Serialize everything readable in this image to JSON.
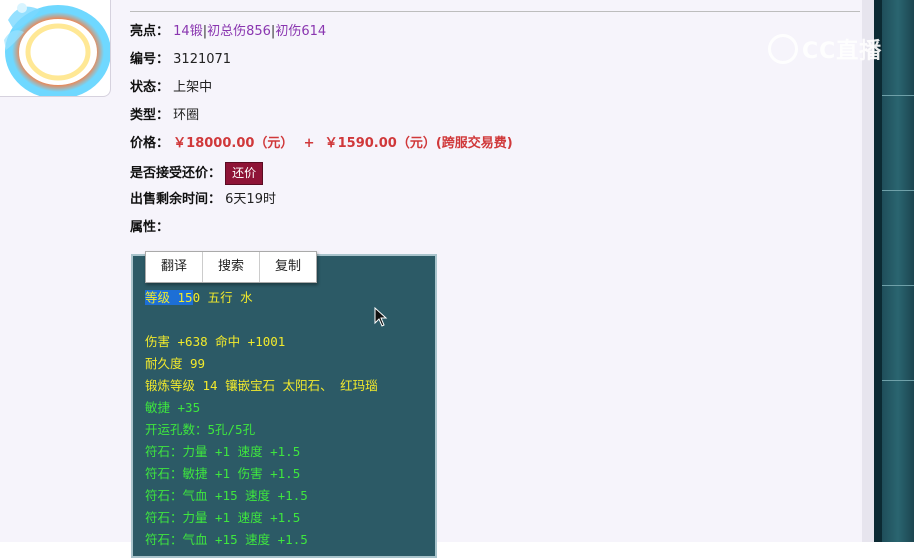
{
  "item": {
    "highlight_label": "亮点：",
    "highlights": [
      "14锻",
      "初总伤856",
      "初伤614"
    ],
    "highlight_sep": "|",
    "id_label": "编号：",
    "id_value": "3121071",
    "status_label": "状态：",
    "status_value": "上架中",
    "type_label": "类型：",
    "type_value": "环圈",
    "price_label": "价格：",
    "price_value": "￥18000.00（元）",
    "price_plus": "+",
    "fee_value": "￥1590.00（元）(跨服交易费)",
    "bargain_label": "是否接受还价：",
    "bargain_button": "还价",
    "time_label": "出售剩余时间：",
    "time_value": "6天19时",
    "attr_label": "属性："
  },
  "context_menu": {
    "items": [
      "翻译",
      "搜索",
      "复制"
    ]
  },
  "attributes": {
    "level_selected": "等级 15",
    "level_rest": "0 五行 水",
    "lines_yellow": [
      "伤害 +638 命中 +1001",
      "耐久度 99",
      "锻炼等级 14 镶嵌宝石 太阳石、 红玛瑙"
    ],
    "lines_green": [
      "敏捷 +35",
      "开运孔数：5孔/5孔",
      "符石：力量 +1 速度 +1.5",
      "符石：敏捷 +1 伤害 +1.5",
      "符石：气血 +15 速度 +1.5",
      "符石：力量 +1 速度 +1.5",
      "符石：气血 +15 速度 +1.5"
    ]
  },
  "watermark": {
    "text": "CC直播"
  },
  "colors": {
    "attr_bg": "#2c5a66",
    "attr_yellow": "#f2ea2c",
    "attr_green": "#3ee63e",
    "price_red": "#d0383a",
    "highlight_purple": "#8a36b0",
    "bargain_bg": "#8e1436"
  }
}
